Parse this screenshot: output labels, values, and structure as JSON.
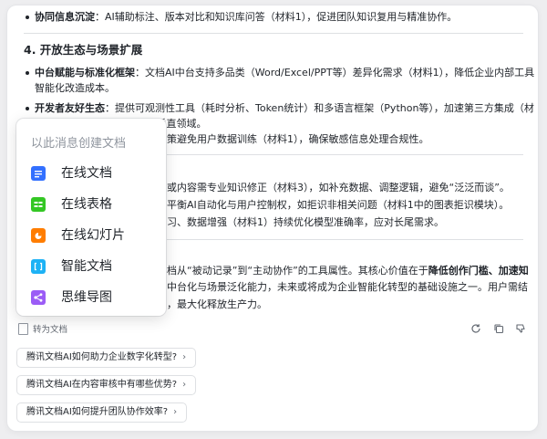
{
  "content": {
    "line_0_bold": "协同信息沉淀",
    "line_0_rest": "：AI辅助标注、版本对比和知识库问答（材料1），促进团队知识复用与精准协作。",
    "section4_title": "4. 开放生态与场景扩展",
    "b1_bold": "中台赋能与标准化框架",
    "b1_rest1": "：文档AI中台支持多品类（Word/Excel/PPT等）差异化需求（材料1），降低企业内部工具",
    "b1_rest2": "智能化改造成本。",
    "b2_bold": "开发者友好生态",
    "b2_rest1": "：提供可观测性工具（耗时分析、Token统计）和多语言框架（Python等），加速第三方集成（材",
    "b2_rest2": "料1），延伸至教育、营销等垂直领域。",
    "line_partial_1": "策避免用户数据训练（材料1），确保敏感信息处理合规性。",
    "line_partial_2": "或内容需专业知识修正（材料3），如补充数据、调整逻辑，避免“泛泛而谈”。",
    "line_partial_3": "平衡AI自动化与用户控制权，如拒识非相关问题（材料1中的图表拒识模块）。",
    "line_partial_4": "习、数据增强（材料1）持续优化模型准确率，应对长尾需求。",
    "concl_1_pre": "档从“被动记录”到“主动协作”的工具属性。其核心价值在于",
    "concl_1_bold": "降低创作门槛、加速知",
    "concl_2": "中台化与场景泛化能力，未来或将成为企业智能化转型的基础设施之一。用户需结",
    "concl_3": "，最大化释放生产力。"
  },
  "menu": {
    "title": "以此消息创建文档",
    "items": [
      {
        "label": "在线文档",
        "icon": "doc-icon",
        "color": "#3370ff"
      },
      {
        "label": "在线表格",
        "icon": "sheet-icon",
        "color": "#34c724"
      },
      {
        "label": "在线幻灯片",
        "icon": "slides-icon",
        "color": "#ff7d00"
      },
      {
        "label": "智能文档",
        "icon": "smart-doc-icon",
        "color": "#1db2f5"
      },
      {
        "label": "思维导图",
        "icon": "mindmap-icon",
        "color": "#9b5cf6"
      }
    ]
  },
  "actions": {
    "to_doc_label": "转为文档",
    "regenerate_icon": "refresh-icon",
    "copy_icon": "copy-icon",
    "dislike_icon": "thumbs-down-icon"
  },
  "suggestions": [
    "腾讯文档AI如何助力企业数字化转型?",
    "腾讯文档AI在内容审核中有哪些优势?",
    "腾讯文档AI如何提升团队协作效率?"
  ]
}
